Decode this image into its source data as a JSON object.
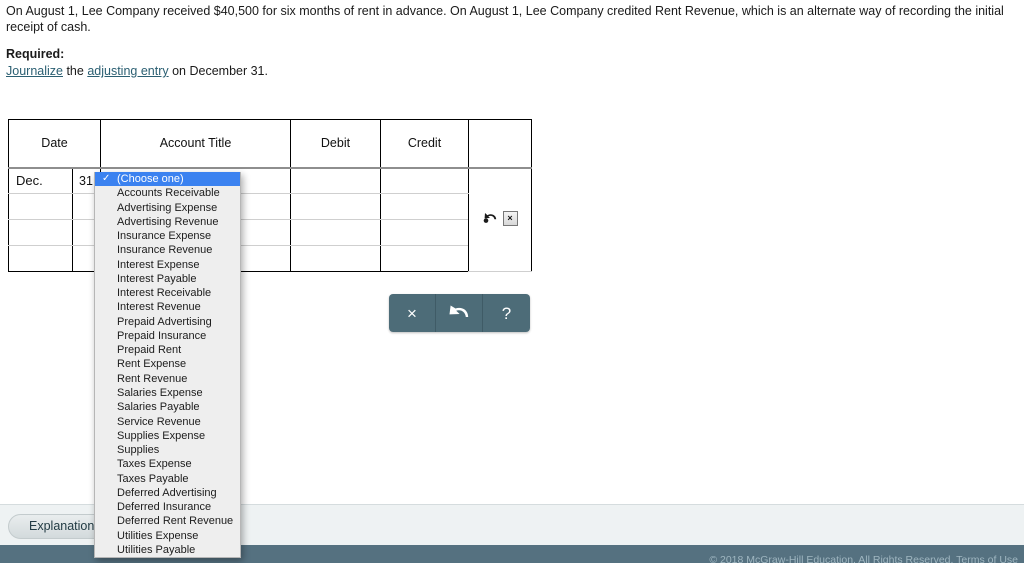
{
  "problem": {
    "statement": "On August 1, Lee Company received $40,500 for six months of rent in advance. On August 1, Lee Company credited Rent Revenue, which is an alternate way of recording the initial receipt of cash.",
    "required_label": "Required:",
    "required_parts": {
      "link1": "Journalize",
      "mid": " the ",
      "link2": "adjusting entry",
      "tail": " on December 31."
    }
  },
  "table": {
    "headers": [
      "Date",
      "Account Title",
      "Debit",
      "Credit",
      ""
    ],
    "rows": [
      {
        "date": "Dec.",
        "day": "31",
        "account": "",
        "debit": "",
        "credit": ""
      },
      {
        "date": "",
        "day": "",
        "account": "",
        "debit": "",
        "credit": ""
      },
      {
        "date": "",
        "day": "",
        "account": "",
        "debit": "",
        "credit": ""
      },
      {
        "date": "",
        "day": "",
        "account": "",
        "debit": "",
        "credit": ""
      }
    ],
    "row_actions": {
      "undo_icon": "undo-arrow-icon",
      "delete_label": "×"
    }
  },
  "dropdown": {
    "selected": "(Choose one)",
    "options": [
      "(Choose one)",
      "Accounts Receivable",
      "Advertising Expense",
      "Advertising Revenue",
      "Insurance Expense",
      "Insurance Revenue",
      "Interest Expense",
      "Interest Payable",
      "Interest Receivable",
      "Interest Revenue",
      "Prepaid Advertising",
      "Prepaid Insurance",
      "Prepaid Rent",
      "Rent Expense",
      "Rent Revenue",
      "Salaries Expense",
      "Salaries Payable",
      "Service Revenue",
      "Supplies Expense",
      "Supplies",
      "Taxes Expense",
      "Taxes Payable",
      "Deferred Advertising",
      "Deferred Insurance",
      "Deferred Rent Revenue",
      "Utilities Expense",
      "Utilities Payable"
    ],
    "highlight_color": "#3b82f0"
  },
  "toolbar": {
    "clear_label": "×",
    "undo_icon": "undo-arrow-icon",
    "help_label": "?",
    "background_color": "#4d6c78"
  },
  "bottom": {
    "explanation_label": "Explanation",
    "footer_text": "© 2018 McGraw-Hill Education. All Rights Reserved.    Terms of Use"
  }
}
